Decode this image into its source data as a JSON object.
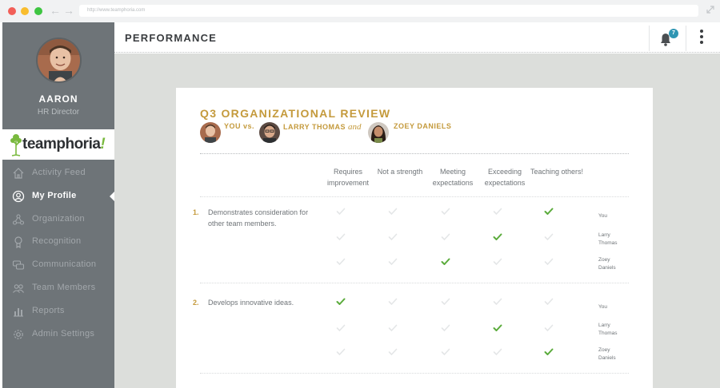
{
  "browser": {
    "url": "http://www.teamphoria.com"
  },
  "sidebar": {
    "user_name": "AARON",
    "user_role": "HR Director",
    "logo_text": "teamphoria",
    "logo_bang": "!",
    "items": [
      {
        "label": "Activity Feed",
        "icon": "home-icon",
        "active": false
      },
      {
        "label": "My Profile",
        "icon": "user-circle-icon",
        "active": true
      },
      {
        "label": "Organization",
        "icon": "organization-icon",
        "active": false
      },
      {
        "label": "Recognition",
        "icon": "award-icon",
        "active": false
      },
      {
        "label": "Communication",
        "icon": "chat-bubbles-icon",
        "active": false
      },
      {
        "label": "Team Members",
        "icon": "people-icon",
        "active": false
      },
      {
        "label": "Reports",
        "icon": "bar-chart-icon",
        "active": false
      },
      {
        "label": "Admin Settings",
        "icon": "gear-icon",
        "active": false
      }
    ]
  },
  "header": {
    "title": "PERFORMANCE",
    "notification_count": "7"
  },
  "review": {
    "title": "Q3 ORGANIZATIONAL REVIEW",
    "you_label": "YOU vs.",
    "peer1": "LARRY THOMAS",
    "and_word": "and",
    "peer2": "ZOEY DANIELS",
    "columns": [
      "Requires improvement",
      "Not a strength",
      "Meeting expectations",
      "Exceeding expectations",
      "Teaching others!"
    ],
    "questions": [
      {
        "number": "1.",
        "text": "Demonstrates consideration for other team members.",
        "rows": [
          {
            "who": "You",
            "selected": 4
          },
          {
            "who": "Larry Thomas",
            "selected": 3
          },
          {
            "who": "Zoey Daniels",
            "selected": 2
          }
        ]
      },
      {
        "number": "2.",
        "text": "Develops innovative ideas.",
        "rows": [
          {
            "who": "You",
            "selected": 0
          },
          {
            "who": "Larry Thomas",
            "selected": 3
          },
          {
            "who": "Zoey Daniels",
            "selected": 4
          }
        ]
      }
    ],
    "colors": {
      "accent": "#c49a3c",
      "check_on": "#5aab3b",
      "check_off": "#e4e6e7"
    }
  }
}
